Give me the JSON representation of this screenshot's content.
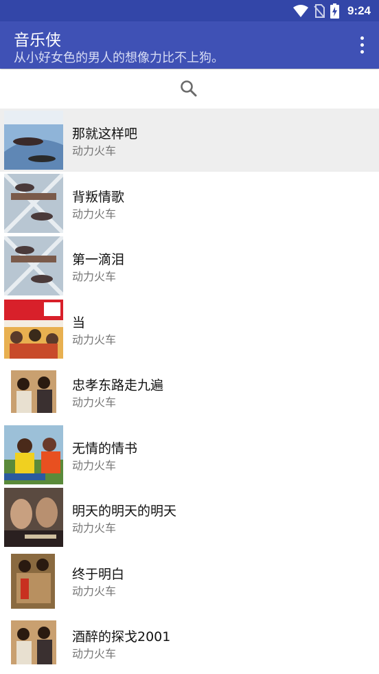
{
  "status_bar": {
    "time": "9:24",
    "icons": [
      "wifi-icon",
      "no-sim-icon",
      "battery-charging-icon"
    ]
  },
  "app_bar": {
    "title": "音乐侠",
    "subtitle": "从小好女色的男人的想像力比不上狗。",
    "menu_icon": "more-vert-icon",
    "color": "#3f51b5",
    "status_color": "#3346a8"
  },
  "search": {
    "icon": "search-icon"
  },
  "songs": [
    {
      "title": "那就这样吧",
      "artist": "动力火车",
      "selected": true
    },
    {
      "title": "背叛情歌",
      "artist": "动力火车"
    },
    {
      "title": "第一滴泪",
      "artist": "动力火车"
    },
    {
      "title": "当",
      "artist": "动力火车"
    },
    {
      "title": "忠孝东路走九遍",
      "artist": "动力火车"
    },
    {
      "title": "无情的情书",
      "artist": "动力火车"
    },
    {
      "title": "明天的明天的明天",
      "artist": "动力火车"
    },
    {
      "title": "终于明白",
      "artist": "动力火车"
    },
    {
      "title": "酒醉的探戈2001",
      "artist": "动力火车"
    }
  ]
}
